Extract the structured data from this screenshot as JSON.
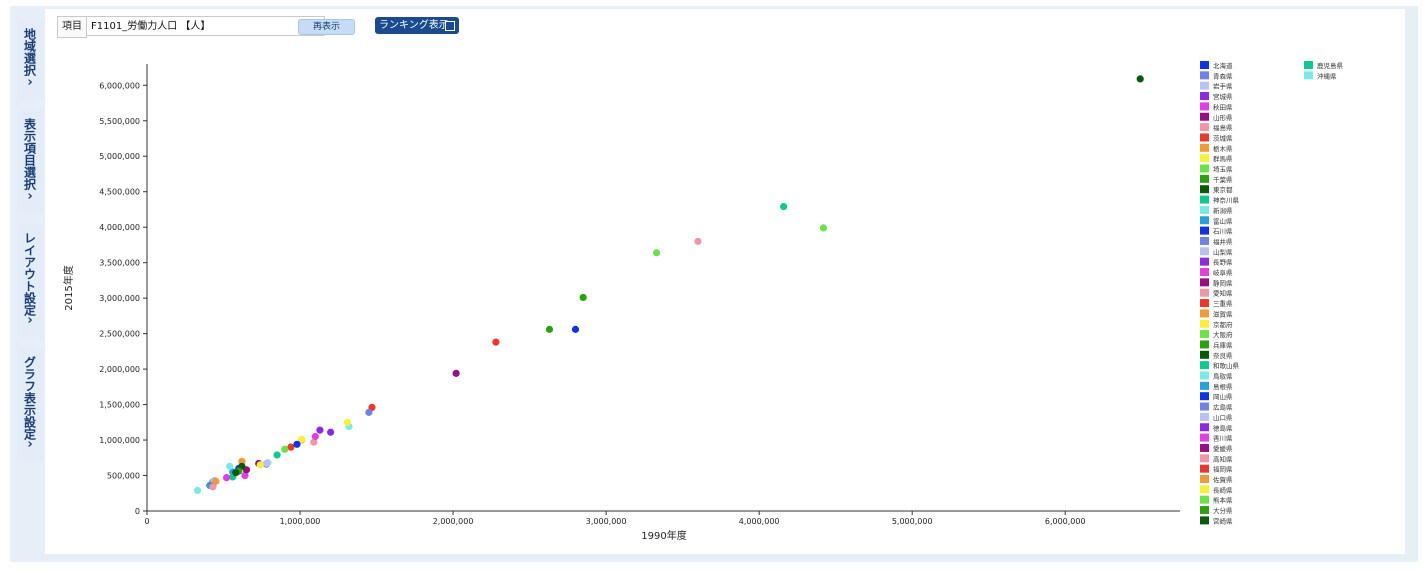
{
  "sidebar": {
    "tabs": [
      {
        "label": "地域選択",
        "chevron": "›"
      },
      {
        "label": "表示項目選択",
        "chevron": "›"
      },
      {
        "label": "レイアウト設定",
        "chevron": "›"
      },
      {
        "label": "グラフ表示設定",
        "chevron": "›"
      }
    ]
  },
  "toolbar": {
    "item_label": "項目",
    "select_value": "F1101_労働力人口 【人】",
    "redisplay_label": "再表示",
    "ranking_label": "ランキング表示"
  },
  "chart_data": {
    "type": "scatter",
    "xlabel": "1990年度",
    "ylabel": "2015年度",
    "xlim": [
      0,
      6750000
    ],
    "ylim": [
      0,
      6300000
    ],
    "xticks": [
      0,
      1000000,
      2000000,
      3000000,
      4000000,
      5000000,
      6000000
    ],
    "yticks": [
      0,
      500000,
      1000000,
      1500000,
      2000000,
      2500000,
      3000000,
      3500000,
      4000000,
      4500000,
      5000000,
      5500000,
      6000000
    ],
    "xtick_labels": [
      "0",
      "1,000,000",
      "2,000,000",
      "3,000,000",
      "4,000,000",
      "5,000,000",
      "6,000,000"
    ],
    "ytick_labels": [
      "0",
      "500,000",
      "1,000,000",
      "1,500,000",
      "2,000,000",
      "2,500,000",
      "3,000,000",
      "3,500,000",
      "4,000,000",
      "4,500,000",
      "5,000,000",
      "5,500,000",
      "6,000,000"
    ],
    "grid": false,
    "legend_position": "right",
    "series": [
      {
        "name": "北海道",
        "color": "#1033e6",
        "x": 2800000,
        "y": 2560000
      },
      {
        "name": "青森県",
        "color": "#6f82e8",
        "x": 780000,
        "y": 660000
      },
      {
        "name": "岩手県",
        "color": "#b7c1f2",
        "x": 780000,
        "y": 670000
      },
      {
        "name": "宮城県",
        "color": "#8a2be2",
        "x": 1130000,
        "y": 1140000
      },
      {
        "name": "秋田県",
        "color": "#e040e0",
        "x": 640000,
        "y": 500000
      },
      {
        "name": "山形県",
        "color": "#9a0e84",
        "x": 650000,
        "y": 580000
      },
      {
        "name": "福島県",
        "color": "#ef96a8",
        "x": 1090000,
        "y": 970000
      },
      {
        "name": "茨城県",
        "color": "#e83a2c",
        "x": 1470000,
        "y": 1460000
      },
      {
        "name": "栃木県",
        "color": "#f09a3a",
        "x": 1010000,
        "y": 1000000
      },
      {
        "name": "群馬県",
        "color": "#f6f03a",
        "x": 1010000,
        "y": 1010000
      },
      {
        "name": "埼玉県",
        "color": "#6ee04a",
        "x": 3330000,
        "y": 3640000
      },
      {
        "name": "千葉県",
        "color": "#2ca010",
        "x": 2850000,
        "y": 3010000
      },
      {
        "name": "東京都",
        "color": "#0b5a0b",
        "x": 6490000,
        "y": 6090000
      },
      {
        "name": "神奈川県",
        "color": "#10c890",
        "x": 4160000,
        "y": 4290000
      },
      {
        "name": "新潟県",
        "color": "#7de8e8",
        "x": 1320000,
        "y": 1190000
      },
      {
        "name": "富山県",
        "color": "#2aa0d8",
        "x": 560000,
        "y": 550000
      },
      {
        "name": "石川県",
        "color": "#1033e6",
        "x": 600000,
        "y": 600000
      },
      {
        "name": "福井県",
        "color": "#6f82e8",
        "x": 430000,
        "y": 410000
      },
      {
        "name": "山梨県",
        "color": "#b7c1f2",
        "x": 440000,
        "y": 430000
      },
      {
        "name": "長野県",
        "color": "#8a2be2",
        "x": 1200000,
        "y": 1110000
      },
      {
        "name": "岐阜県",
        "color": "#e040e0",
        "x": 1100000,
        "y": 1050000
      },
      {
        "name": "静岡県",
        "color": "#9a0e84",
        "x": 2020000,
        "y": 1940000
      },
      {
        "name": "愛知県",
        "color": "#ef96a8",
        "x": 3600000,
        "y": 3800000
      },
      {
        "name": "三重県",
        "color": "#e83a2c",
        "x": 940000,
        "y": 900000
      },
      {
        "name": "滋賀県",
        "color": "#f09a3a",
        "x": 620000,
        "y": 700000
      },
      {
        "name": "京都府",
        "color": "#f6f03a",
        "x": 1310000,
        "y": 1250000
      },
      {
        "name": "大阪府",
        "color": "#6ee04a",
        "x": 4420000,
        "y": 3990000
      },
      {
        "name": "兵庫県",
        "color": "#2ca010",
        "x": 2630000,
        "y": 2560000
      },
      {
        "name": "奈良県",
        "color": "#0b5a0b",
        "x": 620000,
        "y": 630000
      },
      {
        "name": "和歌山県",
        "color": "#10c890",
        "x": 560000,
        "y": 480000
      },
      {
        "name": "鳥取県",
        "color": "#7de8e8",
        "x": 330000,
        "y": 290000
      },
      {
        "name": "島根県",
        "color": "#2aa0d8",
        "x": 410000,
        "y": 360000
      },
      {
        "name": "岡山県",
        "color": "#1033e6",
        "x": 980000,
        "y": 940000
      },
      {
        "name": "広島県",
        "color": "#6f82e8",
        "x": 1450000,
        "y": 1390000
      },
      {
        "name": "山口県",
        "color": "#b7c1f2",
        "x": 790000,
        "y": 680000
      },
      {
        "name": "徳島県",
        "color": "#8a2be2",
        "x": 430000,
        "y": 350000
      },
      {
        "name": "香川県",
        "color": "#e040e0",
        "x": 520000,
        "y": 470000
      },
      {
        "name": "愛媛県",
        "color": "#9a0e84",
        "x": 730000,
        "y": 670000
      },
      {
        "name": "高知県",
        "color": "#ef96a8",
        "x": 430000,
        "y": 340000
      },
      {
        "name": "福岡県",
        "color": "#e83a2c",
        "x": 2280000,
        "y": 2380000
      },
      {
        "name": "佐賀県",
        "color": "#f09a3a",
        "x": 450000,
        "y": 420000
      },
      {
        "name": "長崎県",
        "color": "#f6f03a",
        "x": 740000,
        "y": 650000
      },
      {
        "name": "熊本県",
        "color": "#6ee04a",
        "x": 900000,
        "y": 870000
      },
      {
        "name": "大分県",
        "color": "#2ca010",
        "x": 600000,
        "y": 560000
      },
      {
        "name": "宮崎県",
        "color": "#0b5a0b",
        "x": 580000,
        "y": 540000
      },
      {
        "name": "鹿児島県",
        "color": "#10c890",
        "x": 850000,
        "y": 790000
      },
      {
        "name": "沖縄県",
        "color": "#7de8e8",
        "x": 540000,
        "y": 630000
      }
    ]
  }
}
